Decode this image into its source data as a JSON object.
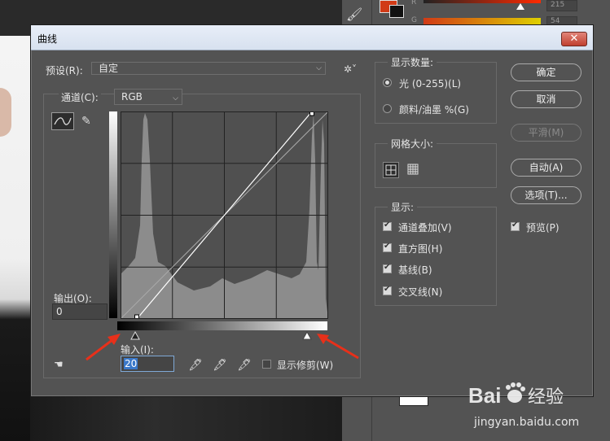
{
  "background": {
    "slider_r_value": "215",
    "slider_g_value": "54",
    "label_r": "R",
    "label_g": "G",
    "fg_color": "#d13a16",
    "bg_color": "#111111"
  },
  "dialog": {
    "title": "曲线",
    "close": "✕",
    "preset_label": "预设(R):",
    "preset_value": "自定",
    "channel_label": "通道(C):",
    "channel_value": "RGB",
    "output_label": "输出(O):",
    "output_value": "0",
    "input_label": "输入(I):",
    "input_value": "20",
    "show_clipping_label": "显示修剪(W)",
    "show_amount": {
      "title": "显示数量:",
      "options": [
        "光 (0-255)(L)",
        "颜料/油墨 %(G)"
      ],
      "selected": 0
    },
    "grid_size": {
      "title": "网格大小:",
      "selected": "simple-grid"
    },
    "show": {
      "title": "显示:",
      "items": [
        "通道叠加(V)",
        "直方图(H)",
        "基线(B)",
        "交叉线(N)"
      ],
      "checked": [
        true,
        true,
        true,
        true
      ]
    },
    "buttons": {
      "ok": "确定",
      "cancel": "取消",
      "smooth": "平滑(M)",
      "auto": "自动(A)",
      "options": "选项(T)..."
    },
    "preview_label": "预览(P)",
    "preview_checked": true
  },
  "curve": {
    "black_point_input": 20,
    "white_point_input": 235
  },
  "watermark": {
    "brand": "Bai",
    "brand_cn": "经验",
    "url": "jingyan.baidu.com"
  }
}
